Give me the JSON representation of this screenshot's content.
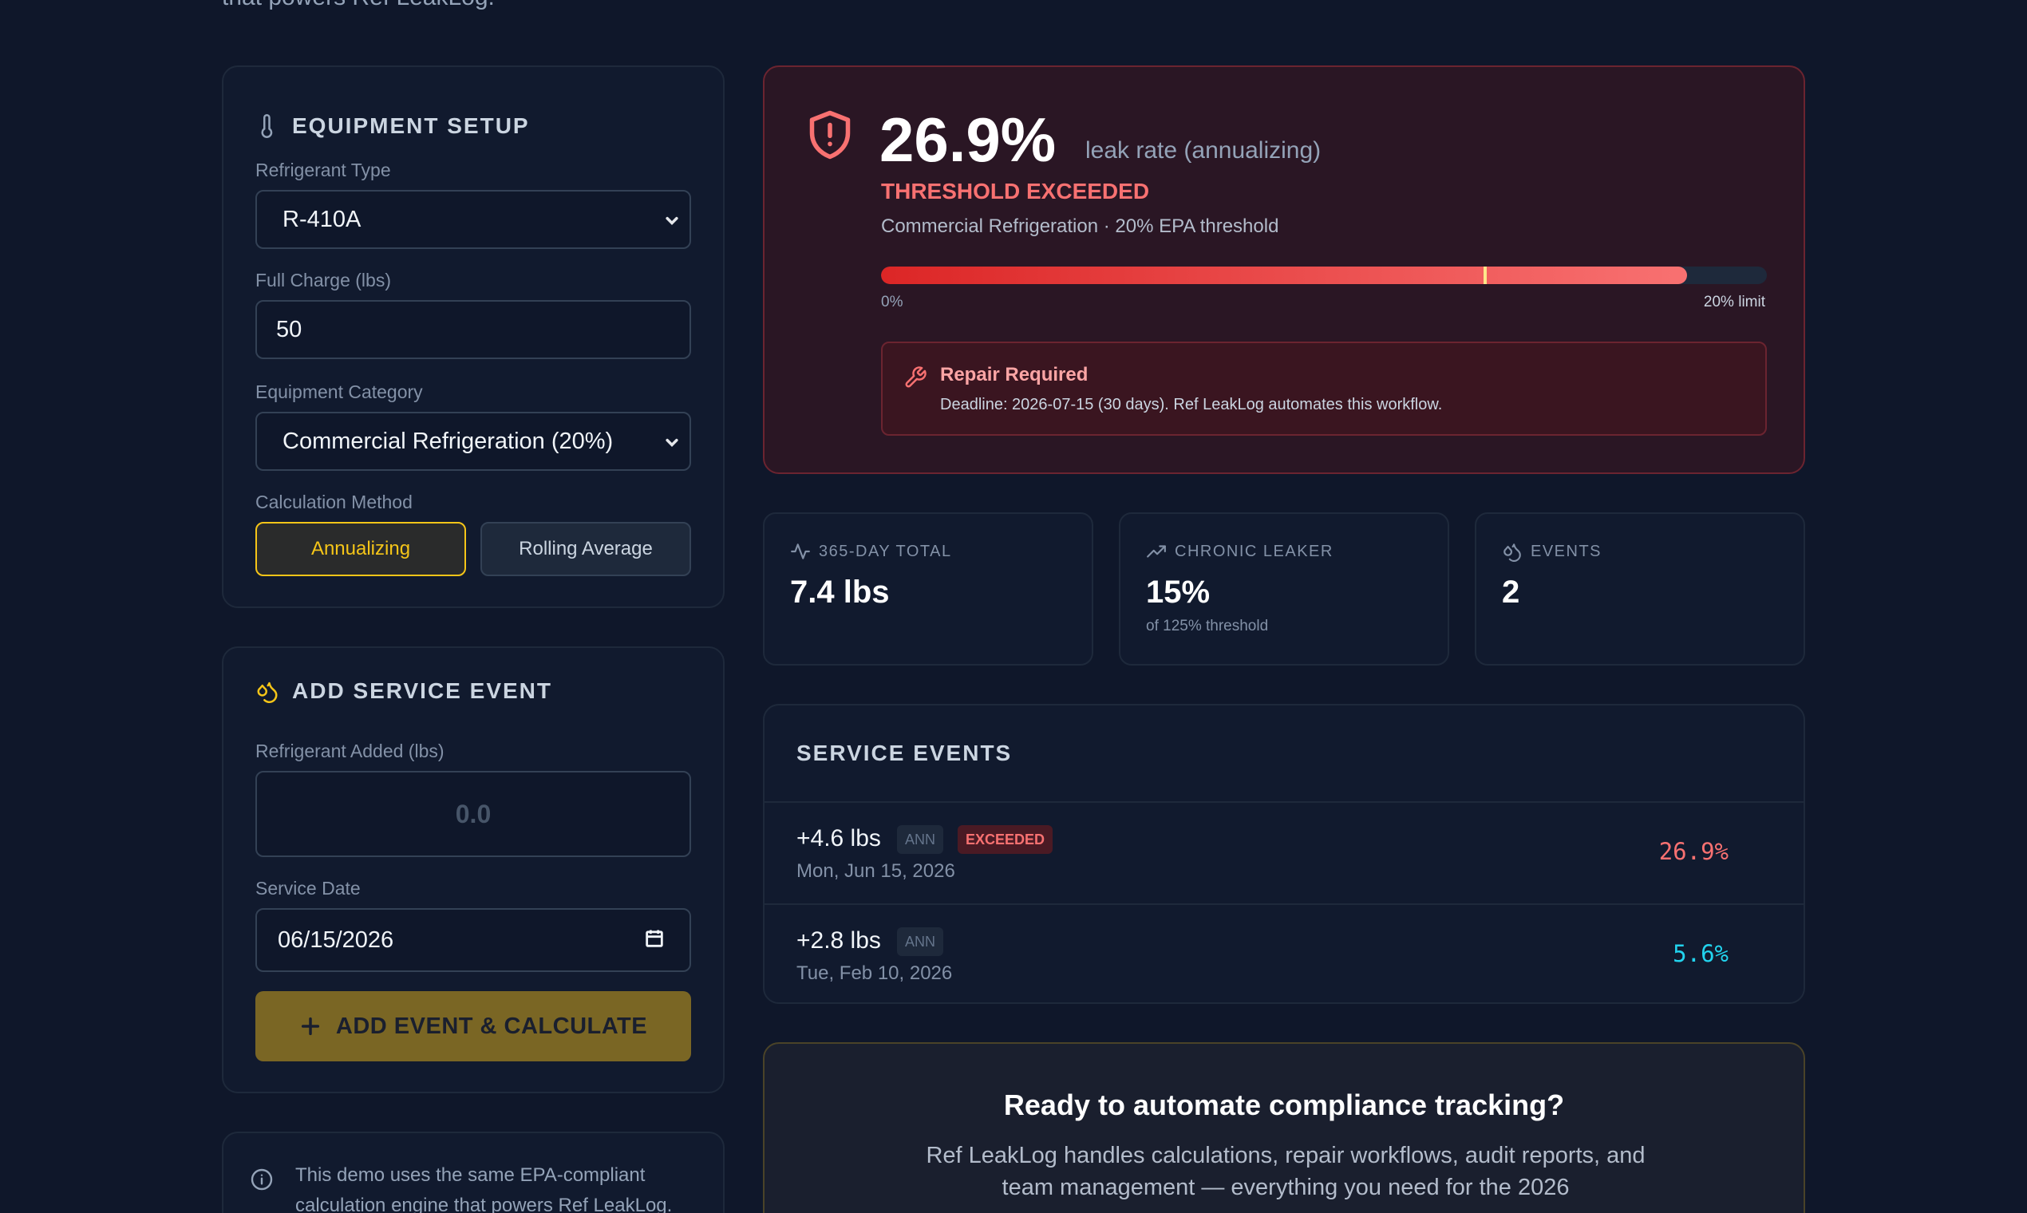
{
  "intro": {
    "tail": "that powers Ref LeakLog."
  },
  "equipment": {
    "title": "EQUIPMENT SETUP",
    "refrigerant_label": "Refrigerant Type",
    "refrigerant_value": "R-410A",
    "charge_label": "Full Charge (lbs)",
    "charge_value": "50",
    "category_label": "Equipment Category",
    "category_value": "Commercial Refrigeration (20%)",
    "method_label": "Calculation Method",
    "method_options": [
      "Annualizing",
      "Rolling Average"
    ],
    "method_selected": "Annualizing"
  },
  "service": {
    "title": "ADD SERVICE EVENT",
    "added_label": "Refrigerant Added (lbs)",
    "added_placeholder": "0.0",
    "date_label": "Service Date",
    "date_value": "06/15/2026",
    "submit_label": "ADD EVENT & CALCULATE"
  },
  "note": {
    "text": "This demo uses the same EPA-compliant calculation engine that powers Ref LeakLog."
  },
  "result": {
    "rate": "26.9%",
    "rate_label": "leak rate (annualizing)",
    "status": "THRESHOLD EXCEEDED",
    "subtitle": "Commercial Refrigeration · 20% EPA threshold",
    "bar_fill_fraction": 0.91,
    "bar_marker_fraction": 0.68,
    "bar_min_label": "0%",
    "bar_max_label": "20% limit",
    "alert_title": "Repair Required",
    "alert_body": "Deadline: 2026-07-15 (30 days). Ref LeakLog automates this workflow."
  },
  "stats": [
    {
      "label": "365-DAY TOTAL",
      "value": "7.4 lbs",
      "sub": ""
    },
    {
      "label": "CHRONIC LEAKER",
      "value": "15%",
      "sub": "of 125% threshold"
    },
    {
      "label": "EVENTS",
      "value": "2",
      "sub": ""
    }
  ],
  "events": {
    "title": "SERVICE EVENTS",
    "rows": [
      {
        "amount": "+4.6 lbs",
        "method_tag": "ANN",
        "status_tag": "EXCEEDED",
        "date": "Mon, Jun 15, 2026",
        "pct": "26.9%",
        "pct_color": "#f87171"
      },
      {
        "amount": "+2.8 lbs",
        "method_tag": "ANN",
        "status_tag": "",
        "date": "Tue, Feb 10, 2026",
        "pct": "5.6%",
        "pct_color": "#22d3ee"
      }
    ]
  },
  "cta": {
    "title": "Ready to automate compliance tracking?",
    "body": "Ref LeakLog handles calculations, repair workflows, audit reports, and team management — everything you need for the 2026"
  },
  "colors": {
    "accent": "#f5c518",
    "danger": "#f87171",
    "ok": "#22d3ee"
  }
}
